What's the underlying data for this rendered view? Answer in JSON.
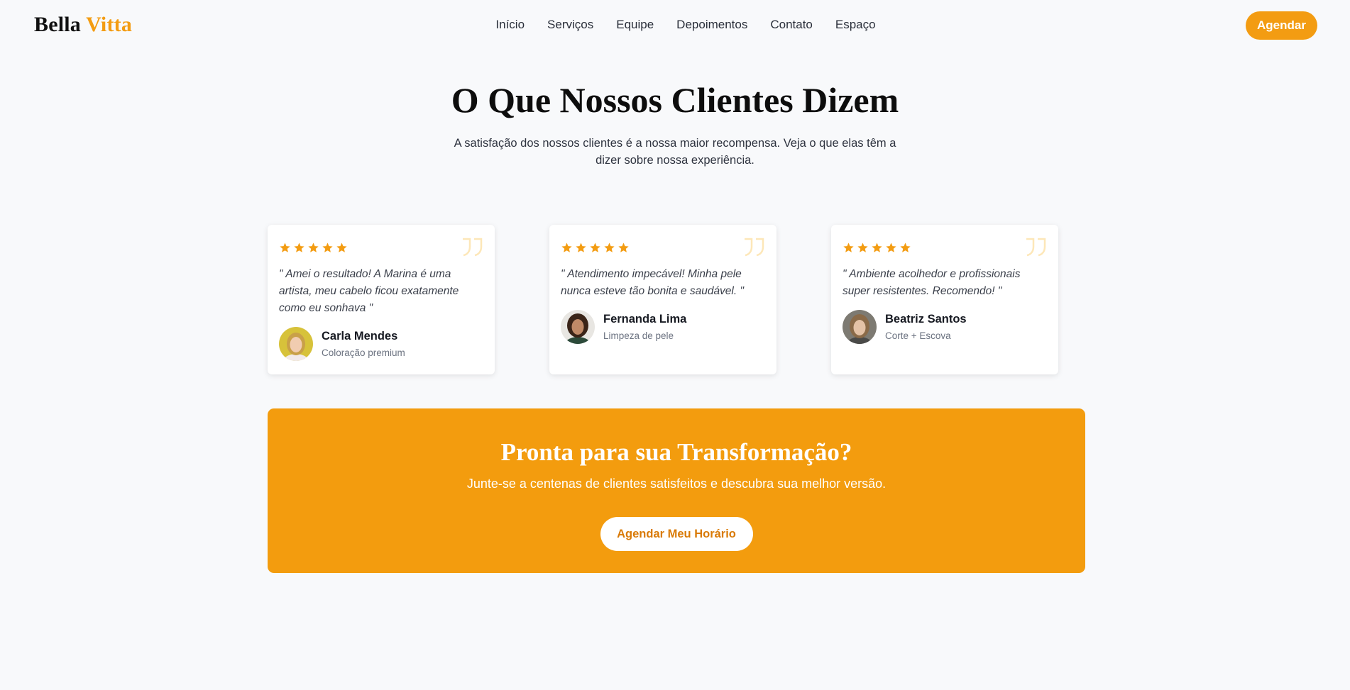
{
  "header": {
    "logo_part1": "Bella",
    "logo_part2": "Vitta",
    "nav": [
      "Início",
      "Serviços",
      "Equipe",
      "Depoimentos",
      "Contato",
      "Espaço"
    ],
    "cta_label": "Agendar"
  },
  "section": {
    "title": "O Que Nossos Clientes Dizem",
    "subtitle": "A satisfação dos nossos clientes é a nossa maior recompensa. Veja o que elas têm a dizer sobre nossa experiência."
  },
  "testimonials": [
    {
      "rating": 5,
      "text": "\" Amei o resultado! A Marina é uma artista, meu cabelo ficou exatamente como eu sonhava \"",
      "name": "Carla Mendes",
      "service": "Coloração premium"
    },
    {
      "rating": 5,
      "text": "\" Atendimento impecável! Minha pele nunca esteve tão bonita e saudável. \"",
      "name": "Fernanda Lima",
      "service": "Limpeza de pele"
    },
    {
      "rating": 5,
      "text": "\" Ambiente acolhedor e profissionais super resistentes. Recomendo! \"",
      "name": "Beatriz Santos",
      "service": "Corte + Escova"
    }
  ],
  "banner": {
    "title": "Pronta para sua Transformação?",
    "text": "Junte-se a centenas de clientes satisfeitos e descubra sua melhor versão.",
    "button_label": "Agendar Meu Horário"
  },
  "colors": {
    "accent": "#f39c12",
    "star": "#f39c12",
    "quote": "#fde7b8"
  },
  "icons": [
    "star-icon",
    "quote-icon"
  ]
}
